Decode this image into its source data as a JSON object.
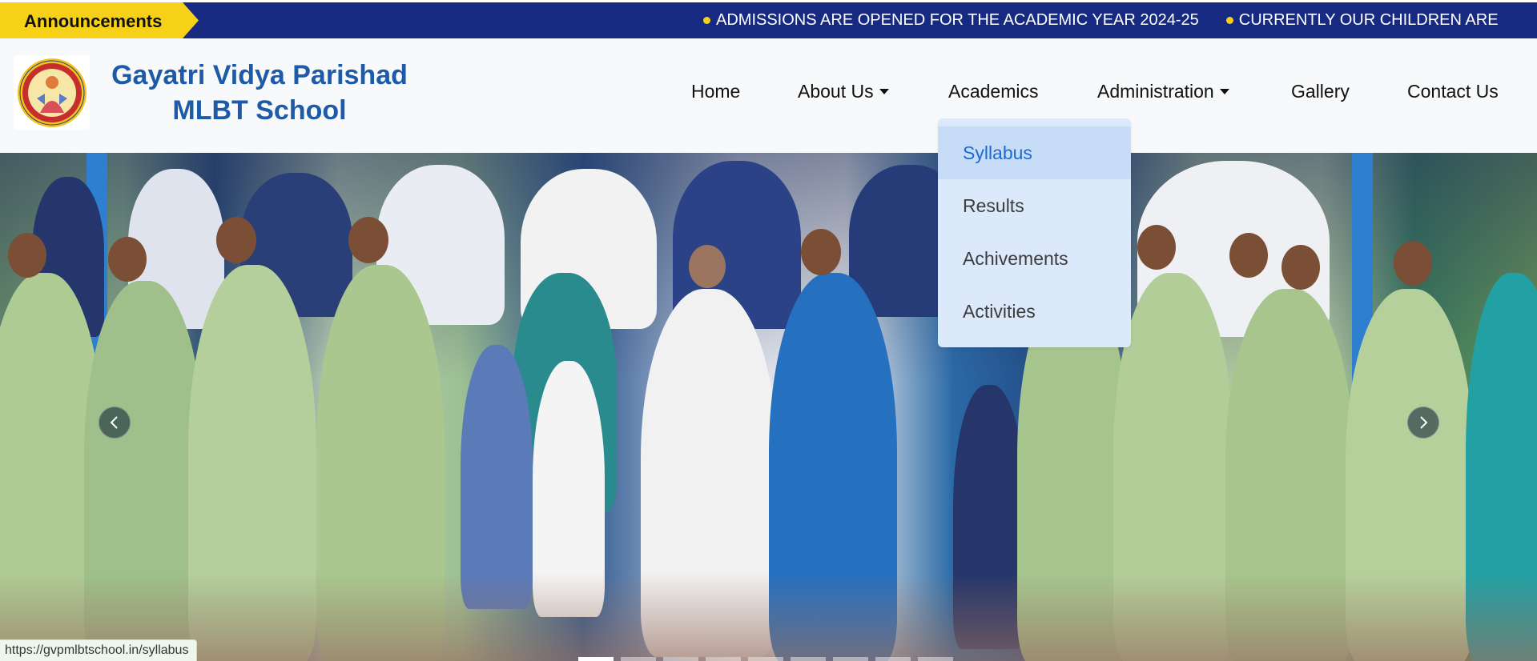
{
  "announcements": {
    "label": "Announcements",
    "items": [
      "ADMISSIONS ARE OPENED FOR THE ACADEMIC YEAR 2024-25",
      "CURRENTLY OUR CHILDREN ARE"
    ]
  },
  "header": {
    "school_name_line1": "Gayatri Vidya Parishad",
    "school_name_line2": "MLBT School"
  },
  "nav": {
    "items": [
      {
        "label": "Home",
        "has_dropdown": false
      },
      {
        "label": "About Us",
        "has_dropdown": true
      },
      {
        "label": "Academics",
        "has_dropdown": false
      },
      {
        "label": "Administration",
        "has_dropdown": true
      },
      {
        "label": "Gallery",
        "has_dropdown": false
      },
      {
        "label": "Contact Us",
        "has_dropdown": false
      }
    ]
  },
  "academics_dropdown": {
    "items": [
      "Syllabus",
      "Results",
      "Achivements",
      "Activities"
    ],
    "highlighted": "Syllabus"
  },
  "carousel": {
    "slide_count": 9,
    "active_index": 0,
    "icons": {
      "prev": "chevron-left-icon",
      "next": "chevron-right-icon"
    }
  },
  "status_bar": {
    "url": "https://gvpmlbtschool.in/syllabus"
  },
  "colors": {
    "announcement_bg": "#172a82",
    "announcement_label_bg": "#f7d117",
    "school_name": "#1d5aa8",
    "dropdown_bg": "#dbe9fb",
    "dropdown_active_text": "#1e6ad4"
  }
}
